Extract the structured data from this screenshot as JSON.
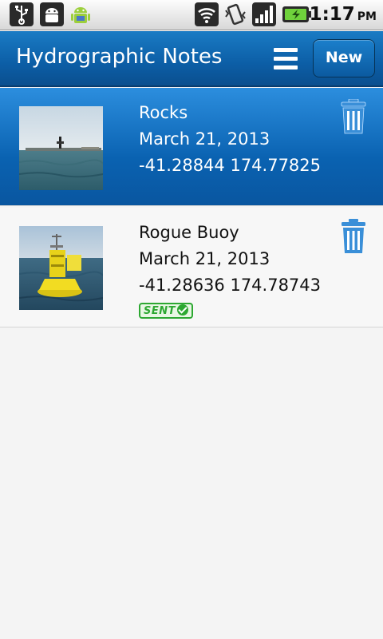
{
  "status_bar": {
    "icons": [
      "usb-icon",
      "android-debug-icon",
      "android-notification-icon",
      "wifi-icon",
      "vibrate-icon",
      "signal-icon",
      "battery-charging-icon"
    ],
    "time": "1:17",
    "ampm": "PM"
  },
  "action_bar": {
    "title": "Hydrographic Notes",
    "menu_icon": "menu-icon",
    "new_label": "New"
  },
  "notes": [
    {
      "title": "Rocks",
      "date": "March 21, 2013",
      "coords": "-41.28844 174.77825",
      "selected": true,
      "thumbnail": "rocks-photo",
      "sent": false
    },
    {
      "title": "Rogue Buoy",
      "date": "March 21, 2013",
      "coords": "-41.28636 174.78743",
      "selected": false,
      "thumbnail": "buoy-photo",
      "sent": true,
      "sent_label": "SENT"
    }
  ],
  "colors": {
    "action_bar": "#0c5ea6",
    "selected_row": "#0a62b1",
    "trash_icon": "#3a8fd8",
    "sent_badge": "#2da832"
  }
}
